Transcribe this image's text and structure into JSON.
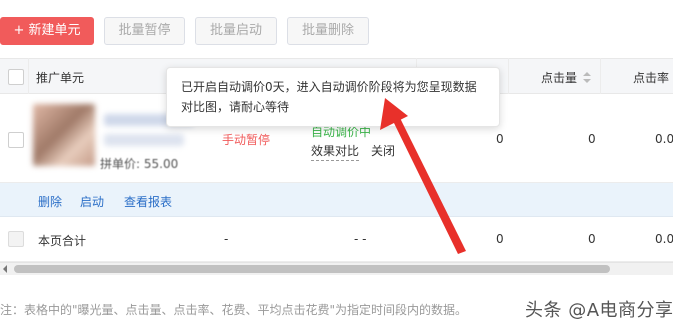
{
  "toolbar": {
    "new_unit_label": "+ 新建单元",
    "batch_pause_label": "批量暂停",
    "batch_start_label": "批量启动",
    "batch_delete_label": "批量删除"
  },
  "table": {
    "headers": {
      "unit": "推广单元",
      "clicks": "点击量",
      "ctr": "点击率"
    },
    "row1": {
      "price_label": "拼单价: 55.00",
      "status": "手动暂停",
      "auto_bid_status": "自动调价中",
      "compare_link": "效果对比",
      "close_link": "关闭",
      "col_value": "0",
      "clicks": "0",
      "ctr": "0.00"
    },
    "actions": {
      "delete": "删除",
      "start": "启动",
      "view_report": "查看报表"
    },
    "total_row": {
      "label": "本页合计",
      "status": "-",
      "auto_bid": "- -",
      "col_value": "0",
      "clicks": "0",
      "ctr": "0.00"
    }
  },
  "tooltip": {
    "line1": "已开启自动调价0天，进入自动调价阶段将为您呈现数据",
    "line2": "对比图，请耐心等待"
  },
  "note": "注：表格中的\"曝光量、点击量、点击率、花费、平均点击花费\"为指定时间段内的数据。",
  "watermark": "头条 @A电商分享",
  "colors": {
    "primary_red": "#f15b5b",
    "link_blue": "#2a6ec7",
    "success_green": "#3bb54a",
    "arrow_red": "#e8302a"
  }
}
